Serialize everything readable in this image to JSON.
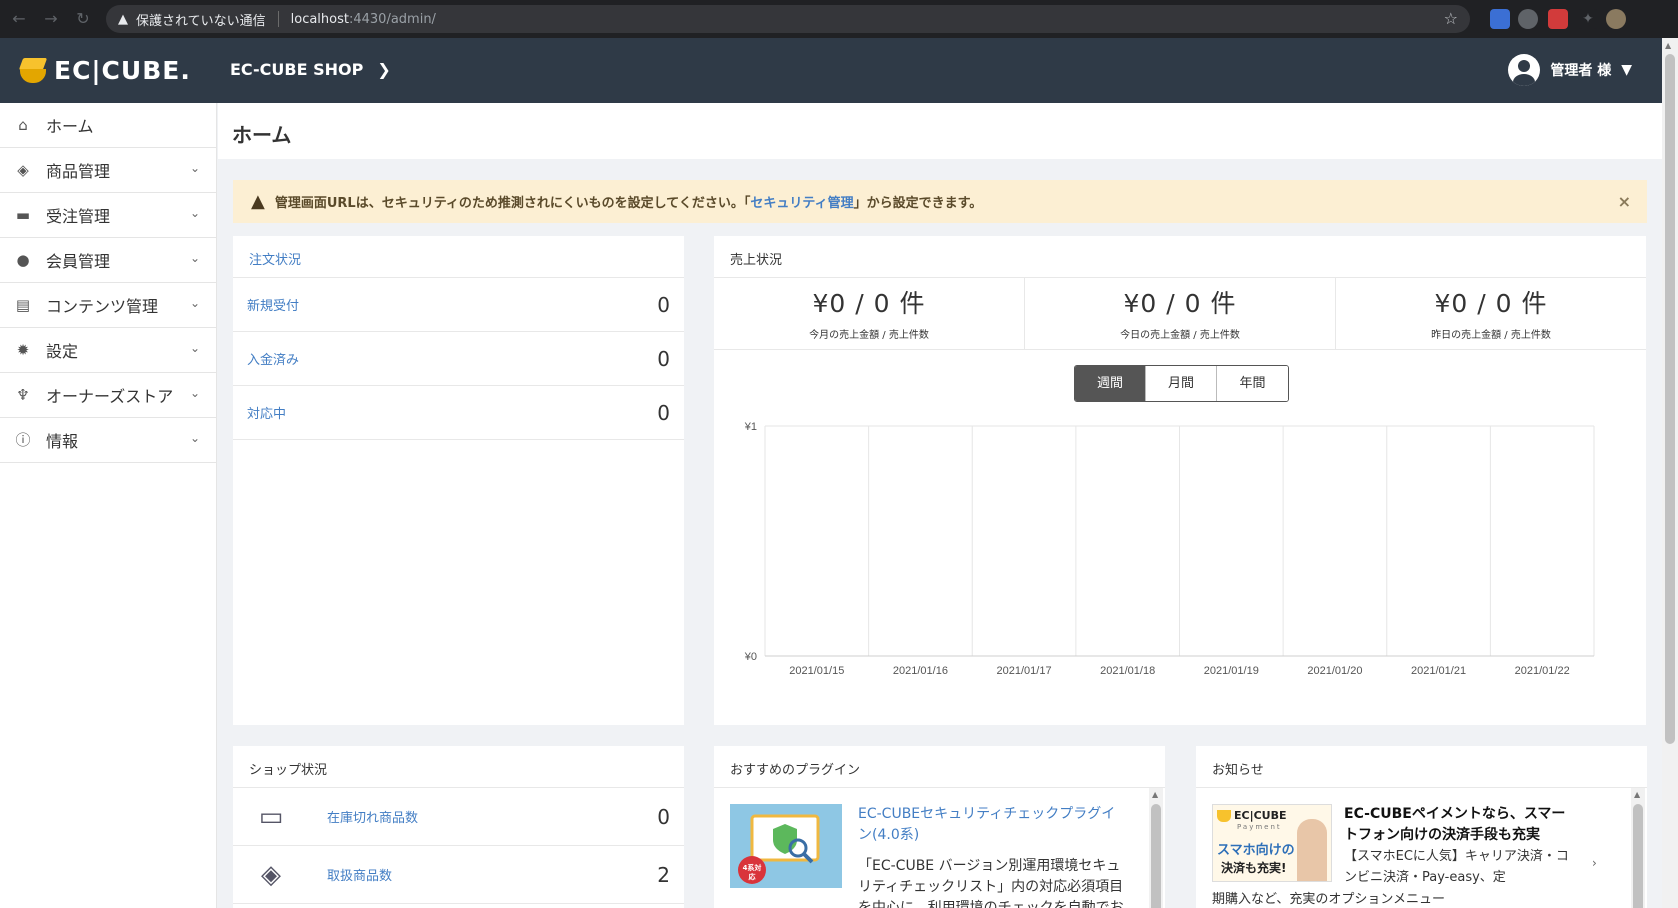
{
  "browser": {
    "security_text": "保護されていない通信",
    "url_host": "localhost",
    "url_path": ":4430/admin/"
  },
  "header": {
    "logo_text": "EC|CUBE.",
    "shop_name": "EC-CUBE SHOP",
    "user_name": "管理者 様"
  },
  "sidebar": {
    "items": [
      {
        "label": "ホーム",
        "icon": "home-icon"
      },
      {
        "label": "商品管理",
        "icon": "cube-icon"
      },
      {
        "label": "受注管理",
        "icon": "cart-icon"
      },
      {
        "label": "会員管理",
        "icon": "users-icon"
      },
      {
        "label": "コンテンツ管理",
        "icon": "file-icon"
      },
      {
        "label": "設定",
        "icon": "gear-icon"
      },
      {
        "label": "オーナーズストア",
        "icon": "plug-icon"
      },
      {
        "label": "情報",
        "icon": "info-icon"
      }
    ]
  },
  "page": {
    "title": "ホーム"
  },
  "alert": {
    "text_before": "管理画面URLは、セキュリティのため推測されにくいものを設定してください。「",
    "link_text": "セキュリティ管理",
    "text_after": "」から設定できます。",
    "close": "×"
  },
  "order_status": {
    "title": "注文状況",
    "rows": [
      {
        "label": "新規受付",
        "value": "0"
      },
      {
        "label": "入金済み",
        "value": "0"
      },
      {
        "label": "対応中",
        "value": "0"
      }
    ]
  },
  "sales": {
    "title": "売上状況",
    "stats": [
      {
        "value": "¥0 / 0 件",
        "label": "今月の売上金額 / 売上件数"
      },
      {
        "value": "¥0 / 0 件",
        "label": "今日の売上金額 / 売上件数"
      },
      {
        "value": "¥0 / 0 件",
        "label": "昨日の売上金額 / 売上件数"
      }
    ],
    "periods": [
      "週間",
      "月間",
      "年間"
    ],
    "active_period": 0
  },
  "chart_data": {
    "type": "line",
    "categories": [
      "2021/01/15",
      "2021/01/16",
      "2021/01/17",
      "2021/01/18",
      "2021/01/19",
      "2021/01/20",
      "2021/01/21",
      "2021/01/22"
    ],
    "series": [
      {
        "values": [
          0,
          0,
          0,
          0,
          0,
          0,
          0,
          0
        ]
      }
    ],
    "y_ticks": [
      "¥1",
      "¥0"
    ],
    "ylim": [
      0,
      1
    ],
    "grid": true,
    "title": "",
    "xlabel": "",
    "ylabel": ""
  },
  "shop_status": {
    "title": "ショップ状況",
    "rows": [
      {
        "label": "在庫切れ商品数",
        "value": "0",
        "icon": "inbox-icon"
      },
      {
        "label": "取扱商品数",
        "value": "2",
        "icon": "cubes-icon"
      }
    ]
  },
  "plugins": {
    "title": "おすすめのプラグイン",
    "item_title": "EC-CUBEセキュリティチェックプラグイン(4.0系)",
    "item_desc": "「EC-CUBE バージョン別運用環境セキュリティチェックリスト」内の対応必須項目を中心に、利用環境のチェックを自動でおこ",
    "badge": "4系対応"
  },
  "news": {
    "title": "お知らせ",
    "item_title": "EC-CUBEペイメントなら、スマートフォン向けの決済手段も充実",
    "item_desc": "【スマホECに人気】キャリア決済・コンビニ決済・Pay-easy、定",
    "item_desc2": "期購入など、充実のオプションメニュー",
    "banner_brand": "EC|CUBE",
    "banner_sub": "Payment",
    "banner_line1": "スマホ向けの",
    "banner_line2": "決済も充実!"
  }
}
